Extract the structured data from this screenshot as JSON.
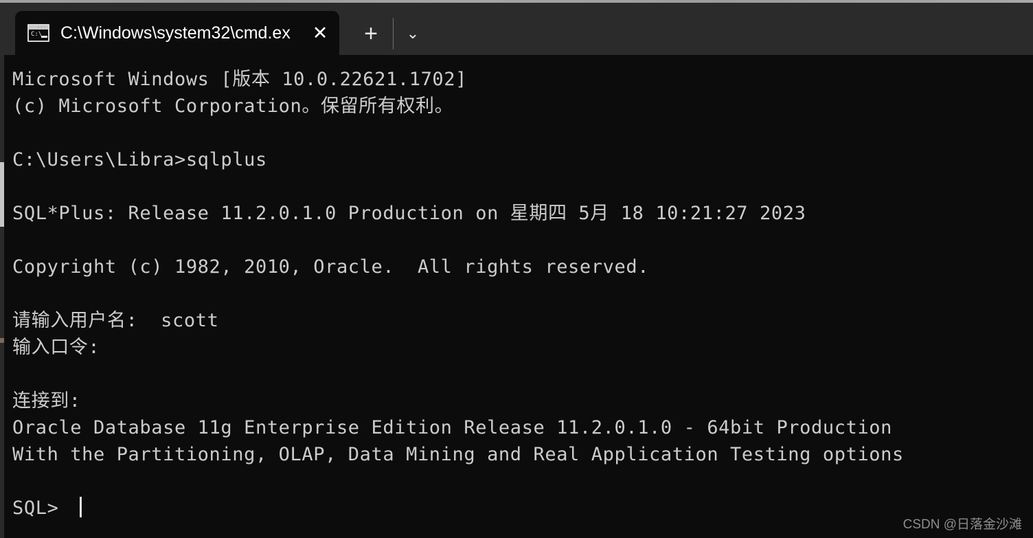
{
  "window": {
    "app": "windows-terminal",
    "tab_bar_color": "#2b2b2b",
    "terminal_bg": "#0c0c0c",
    "terminal_fg": "#cccccc"
  },
  "tabbar": {
    "tab": {
      "icon_name": "cmd-icon",
      "icon_prompt_text": "C:\\",
      "title": "C:\\Windows\\system32\\cmd.ex",
      "close_label": "✕"
    },
    "new_tab_label": "+",
    "dropdown_label": "⌄"
  },
  "terminal": {
    "lines": [
      "Microsoft Windows [版本 10.0.22621.1702]",
      "(c) Microsoft Corporation。保留所有权利。",
      "",
      "C:\\Users\\Libra>sqlplus",
      "",
      "SQL*Plus: Release 11.2.0.1.0 Production on 星期四 5月 18 10:21:27 2023",
      "",
      "Copyright (c) 1982, 2010, Oracle.  All rights reserved.",
      "",
      "请输入用户名:  scott",
      "输入口令:",
      "",
      "连接到:",
      "Oracle Database 11g Enterprise Edition Release 11.2.0.1.0 - 64bit Production",
      "With the Partitioning, OLAP, Data Mining and Real Application Testing options",
      ""
    ],
    "prompt": "SQL> ",
    "cursor_visible": true
  },
  "watermark": {
    "text": "CSDN @日落金沙滩"
  }
}
